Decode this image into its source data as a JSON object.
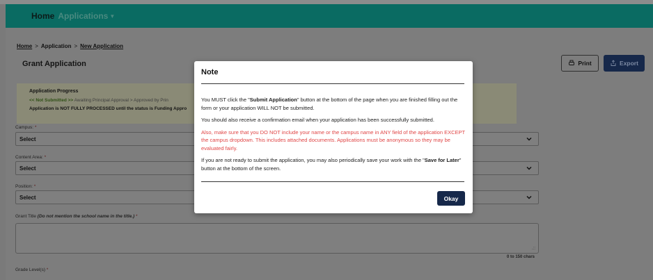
{
  "nav": {
    "home": "Home",
    "applications": "Applications"
  },
  "breadcrumb": {
    "home": "Home",
    "application": "Application",
    "new_application": "New Application",
    "separator": ">"
  },
  "page": {
    "title": "Grant Application"
  },
  "toolbar": {
    "print": "Print",
    "export": "Export"
  },
  "progress": {
    "title": "Application Progress",
    "current_step": "<< Not Submitted >>",
    "next_steps": " Awaiting Principal Approval > Approved by Prin",
    "note": "Application is NOT FULLY PROCESSED until the status is Funding Appro"
  },
  "fields": {
    "campus": {
      "label": "Campus: ",
      "value": "Select"
    },
    "content_area": {
      "label": "Content Area: ",
      "value": "Select"
    },
    "position": {
      "label": "Position: ",
      "value": "Select"
    },
    "grant_title": {
      "label": "Grant Title ",
      "hint": "(Do not mention the school name in the title.)",
      "char_count": "0 to 150 chars"
    },
    "grade_levels": {
      "label": "Grade Level(s) "
    },
    "required_mark": "*"
  },
  "modal": {
    "title": "Note",
    "p1_a": "You MUST click the \"",
    "p1_b": "Submit Application",
    "p1_c": "\" button at the bottom of the page when you are finished filling out the form or your application WILL NOT be submitted.",
    "p2": "You should also receive a confirmation email when your application has been successfully submitted.",
    "p3": "Also, make sure that you DO NOT include your name or the campus name in ANY field of the application EXCEPT the campus dropdown. This includes attached documents. Applications must be anonymous so they may be evaluated fairly.",
    "p4_a": "If you are not ready to submit the application, you may also periodically save your work with the \"",
    "p4_b": "Save for Later",
    "p4_c": "\" button at the bottom of the screen.",
    "okay": "Okay"
  },
  "icons": {
    "print": "printer-icon",
    "export": "export-icon",
    "caret": "caret-down-icon",
    "chevron": "chevron-down-icon"
  },
  "colors": {
    "nav_bg": "#0a6b62",
    "primary_button": "#16284a",
    "warning_text": "#e04545"
  }
}
